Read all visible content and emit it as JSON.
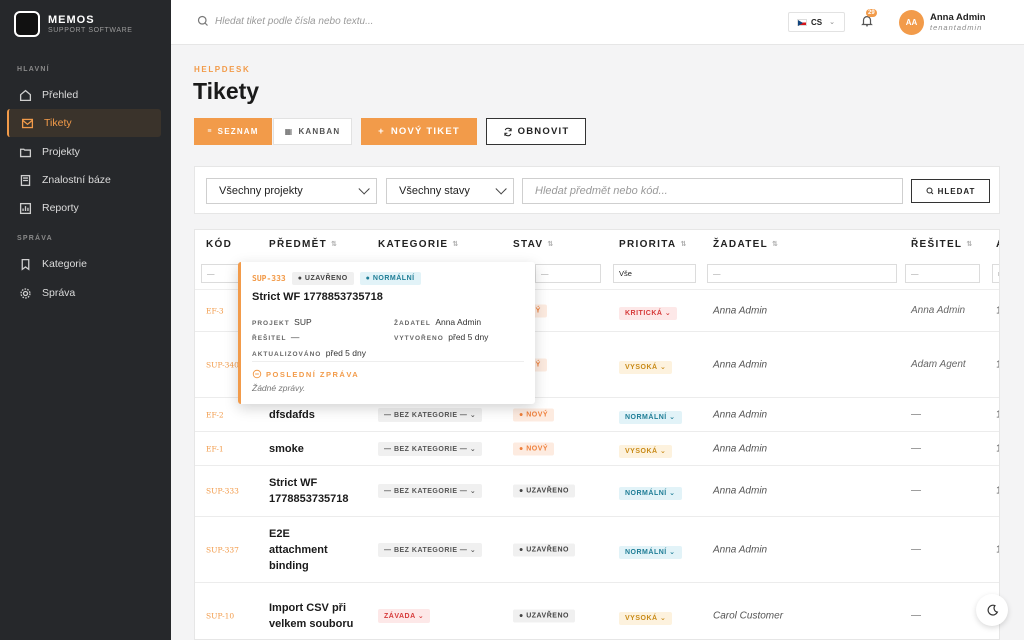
{
  "brand": {
    "name": "MEMOS",
    "subtitle": "SUPPORT SOFTWARE"
  },
  "sidebar": {
    "section_main": "HLAVNÍ",
    "section_admin": "SPRÁVA",
    "items": [
      {
        "label": "Přehled",
        "icon": "home-icon"
      },
      {
        "label": "Tikety",
        "icon": "mail-icon",
        "active": true
      },
      {
        "label": "Projekty",
        "icon": "folder-icon"
      },
      {
        "label": "Znalostní báze",
        "icon": "book-icon"
      },
      {
        "label": "Reporty",
        "icon": "chart-icon"
      },
      {
        "label": "Kategorie",
        "icon": "bookmark-icon"
      },
      {
        "label": "Správa",
        "icon": "gear-icon"
      }
    ]
  },
  "topbar": {
    "search_placeholder": "Hledat tiket podle čísla nebo textu...",
    "lang": "CS",
    "notifications": "29",
    "user_initials": "AA",
    "user_name": "Anna Admin",
    "user_role": "tenantadmin"
  },
  "page": {
    "breadcrumb": "HELPDESK",
    "title": "Tikety"
  },
  "toolbar": {
    "list": "SEZNAM",
    "kanban": "KANBAN",
    "new": "NOVÝ TIKET",
    "refresh": "OBNOVIT"
  },
  "filters": {
    "project": "Všechny projekty",
    "status": "Všechny stavy",
    "search_placeholder": "Hledat předmět nebo kód...",
    "search_button": "HLEDAT"
  },
  "table": {
    "columns": [
      "KÓD",
      "PŘEDMĚT",
      "KATEGORIE",
      "STAV",
      "PRIORITA",
      "ŽADATEL",
      "ŘEŠITEL",
      "A"
    ],
    "filter_values": {
      "generic": "—",
      "priority": "Vše",
      "last": "m"
    },
    "rows": [
      {
        "code": "EF-3",
        "subject": "",
        "category": "",
        "status": "NOVÝ",
        "priority": "KRITICKÁ",
        "requester": "Anna Admin",
        "resolver": "Anna Admin",
        "extra": "1"
      },
      {
        "code": "SUP-340",
        "subject": "",
        "category": "",
        "status": "NOVÝ",
        "priority": "VYSOKÁ",
        "requester": "Anna Admin",
        "resolver": "Adam Agent",
        "extra": "1"
      },
      {
        "code": "EF-2",
        "subject": "dfsdafds",
        "category": "— BEZ KATEGORIE —",
        "status": "NOVÝ",
        "priority": "NORMÁLNÍ",
        "requester": "Anna Admin",
        "resolver": "—",
        "extra": "1"
      },
      {
        "code": "EF-1",
        "subject": "smoke",
        "category": "— BEZ KATEGORIE —",
        "status": "NOVÝ",
        "priority": "VYSOKÁ",
        "requester": "Anna Admin",
        "resolver": "—",
        "extra": "1"
      },
      {
        "code": "SUP-333",
        "subject": "Strict WF 1778853735718",
        "category": "— BEZ KATEGORIE —",
        "status": "UZAVŘENO",
        "priority": "NORMÁLNÍ",
        "requester": "Anna Admin",
        "resolver": "—",
        "extra": "1"
      },
      {
        "code": "SUP-337",
        "subject": "E2E attachment binding",
        "category": "— BEZ KATEGORIE —",
        "status": "UZAVŘENO",
        "priority": "NORMÁLNÍ",
        "requester": "Anna Admin",
        "resolver": "—",
        "extra": "1"
      },
      {
        "code": "SUP-10",
        "subject": "Import CSV při velkem souboru",
        "category": "ZÁVADA",
        "status": "UZAVŘENO",
        "priority": "VYSOKÁ",
        "requester": "Carol Customer",
        "resolver": "—",
        "extra": "1"
      }
    ]
  },
  "popup": {
    "code": "SUP-333",
    "status": "UZAVŘENO",
    "priority": "NORMÁLNÍ",
    "title": "Strict WF 1778853735718",
    "project_label": "PROJEKT",
    "project": "SUP",
    "requester_label": "ŽADATEL",
    "requester": "Anna Admin",
    "resolver_label": "ŘEŠITEL",
    "resolver": "—",
    "created_label": "VYTVOŘENO",
    "created": "před 5 dny",
    "updated_label": "AKTUALIZOVÁNO",
    "updated": "před 5 dny",
    "last_msg_label": "POSLEDNÍ ZPRÁVA",
    "no_messages": "Žádné zprávy."
  }
}
